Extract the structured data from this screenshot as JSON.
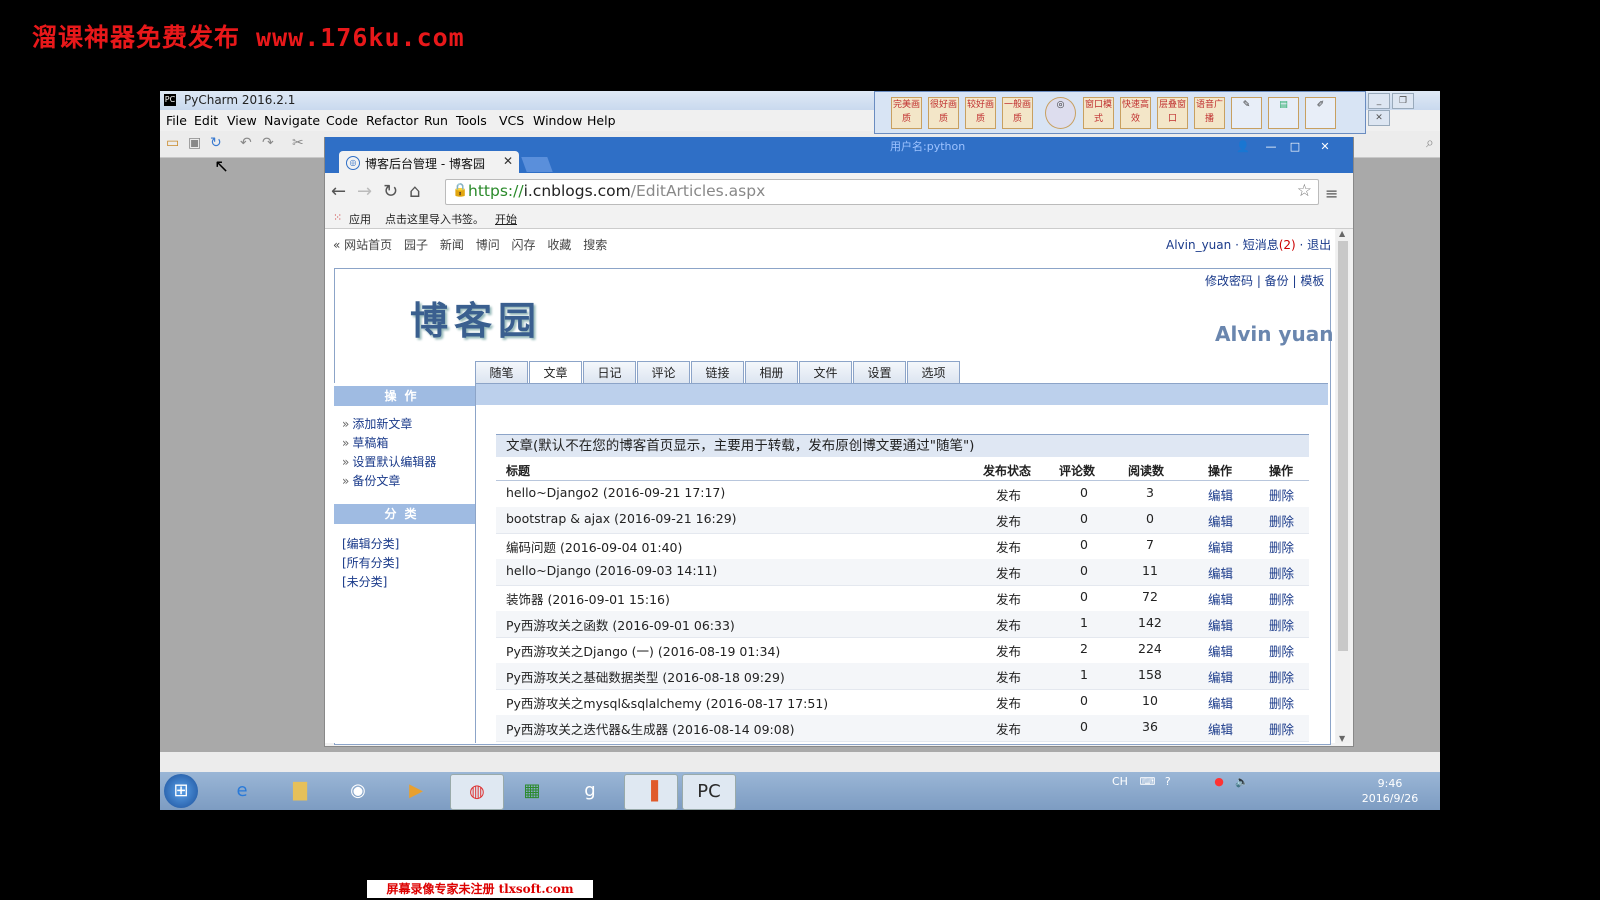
{
  "watermark": {
    "top": "溜课神器免费发布 www.176ku.com",
    "bottom": "屏幕录像专家未注册 tlxsoft.com"
  },
  "pycharm": {
    "title": "PyCharm 2016.2.1",
    "menu": [
      "File",
      "Edit",
      "View",
      "Navigate",
      "Code",
      "Refactor",
      "Run",
      "Tools",
      "VCS",
      "Window",
      "Help"
    ]
  },
  "recorder": {
    "buttons": [
      "完美画质",
      "很好画质",
      "较好画质",
      "一般画质",
      "窗口模式",
      "快速高效",
      "层叠窗口",
      "语音广播"
    ],
    "user_label": "用户名:python"
  },
  "browser": {
    "tab_title": "博客后台管理 - 博客园",
    "url_scheme": "https://",
    "url_host": "i.cnblogs.com",
    "url_path": "/EditArticles.aspx",
    "bookmarks": {
      "apps": "应用",
      "hint": "点击这里导入书签。",
      "start": "开始"
    }
  },
  "site_nav": {
    "items": [
      "« 网站首页",
      "园子",
      "新闻",
      "博问",
      "闪存",
      "收藏",
      "搜索"
    ],
    "user": "Alvin_yuan",
    "messages_label": "短消息",
    "messages_count": "(2)",
    "logout": "退出"
  },
  "blog": {
    "top_links": "修改密码 | 备份 | 模板",
    "logo": "博客园",
    "author": "Alvin yuan",
    "tabs": [
      "随笔",
      "文章",
      "日记",
      "评论",
      "链接",
      "相册",
      "文件",
      "设置",
      "选项"
    ],
    "active_tab": "文章"
  },
  "sidebar": {
    "ops_title": "操作",
    "ops": [
      "添加新文章",
      "草稿箱",
      "设置默认编辑器",
      "备份文章"
    ],
    "cat_title": "分类",
    "cats": [
      "[编辑分类]",
      "[所有分类]",
      "[未分类]"
    ]
  },
  "articles": {
    "section_title": "文章(默认不在您的博客首页显示，主要用于转载，发布原创博文要通过\"随笔\")",
    "headers": [
      "标题",
      "发布状态",
      "评论数",
      "阅读数",
      "操作",
      "操作"
    ],
    "rows": [
      {
        "title": "hello~Django2 (2016-09-21 17:17)",
        "status": "发布",
        "comments": "0",
        "reads": "3",
        "edit": "编辑",
        "del": "删除"
      },
      {
        "title": "bootstrap & ajax (2016-09-21 16:29)",
        "status": "发布",
        "comments": "0",
        "reads": "0",
        "edit": "编辑",
        "del": "删除"
      },
      {
        "title": "编码问题 (2016-09-04 01:40)",
        "status": "发布",
        "comments": "0",
        "reads": "7",
        "edit": "编辑",
        "del": "删除"
      },
      {
        "title": "hello~Django (2016-09-03 14:11)",
        "status": "发布",
        "comments": "0",
        "reads": "11",
        "edit": "编辑",
        "del": "删除"
      },
      {
        "title": "装饰器 (2016-09-01 15:16)",
        "status": "发布",
        "comments": "0",
        "reads": "72",
        "edit": "编辑",
        "del": "删除"
      },
      {
        "title": "Py西游攻关之函数 (2016-09-01 06:33)",
        "status": "发布",
        "comments": "1",
        "reads": "142",
        "edit": "编辑",
        "del": "删除"
      },
      {
        "title": "Py西游攻关之Django (一) (2016-08-19 01:34)",
        "status": "发布",
        "comments": "2",
        "reads": "224",
        "edit": "编辑",
        "del": "删除"
      },
      {
        "title": "Py西游攻关之基础数据类型 (2016-08-18 09:29)",
        "status": "发布",
        "comments": "1",
        "reads": "158",
        "edit": "编辑",
        "del": "删除"
      },
      {
        "title": "Py西游攻关之mysql&sqlalchemy (2016-08-17 17:51)",
        "status": "发布",
        "comments": "0",
        "reads": "10",
        "edit": "编辑",
        "del": "删除"
      },
      {
        "title": "Py西游攻关之迭代器&生成器 (2016-08-14 09:08)",
        "status": "发布",
        "comments": "0",
        "reads": "36",
        "edit": "编辑",
        "del": "删除"
      }
    ]
  },
  "taskbar": {
    "tray_lang": "CH",
    "time": "9:46",
    "date": "2016/9/26"
  }
}
